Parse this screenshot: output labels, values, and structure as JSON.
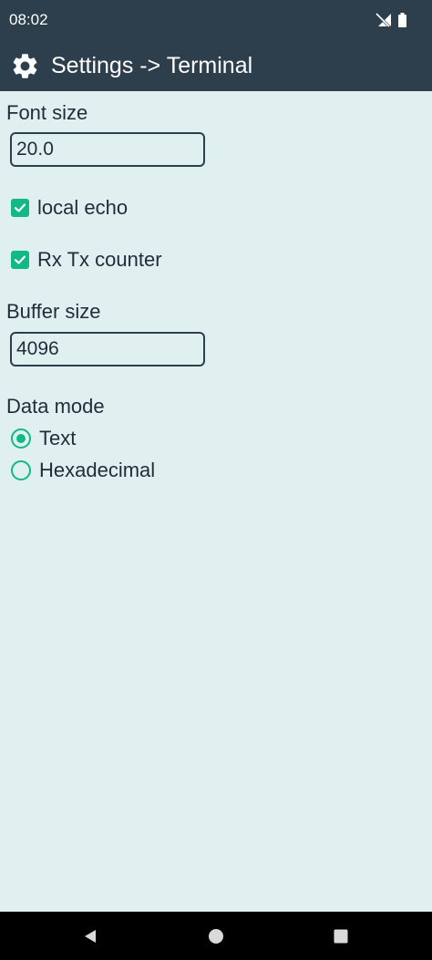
{
  "status_bar": {
    "time": "08:02",
    "icons": [
      "signal-off-icon",
      "battery-icon"
    ]
  },
  "app_bar": {
    "icon": "gear-icon",
    "title": "Settings -> Terminal"
  },
  "settings": {
    "font_size": {
      "label": "Font size",
      "value": "20.0"
    },
    "local_echo": {
      "label": "local echo",
      "checked": true
    },
    "rx_tx_counter": {
      "label": "Rx Tx counter",
      "checked": true
    },
    "buffer_size": {
      "label": "Buffer size",
      "value": "4096"
    },
    "data_mode": {
      "label": "Data mode",
      "options": [
        {
          "label": "Text",
          "selected": true
        },
        {
          "label": "Hexadecimal",
          "selected": false
        }
      ]
    }
  },
  "nav_bar": {
    "buttons": [
      "back-icon",
      "home-icon",
      "recents-icon"
    ]
  },
  "colors": {
    "bar": "#2d3e4c",
    "background": "#e0f0f0",
    "accent": "#12b886",
    "text": "#1f2d3a"
  }
}
